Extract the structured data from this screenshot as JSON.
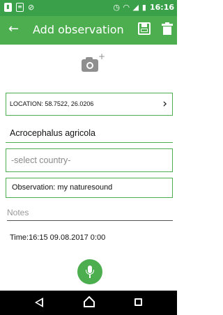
{
  "status_bar": {
    "time": "16:16",
    "icons": [
      "sim-icon",
      "clipboard-icon",
      "no-signal-icon",
      "alarm-icon",
      "wifi-icon",
      "cell-signal-icon",
      "battery-icon"
    ]
  },
  "app_bar": {
    "title": "Add observation",
    "icons": [
      "back-arrow-icon",
      "save-icon",
      "trash-icon"
    ]
  },
  "form": {
    "camera_icon": "add-photo-icon",
    "location": "LOCATION: 58.7522, 26.0206",
    "species": "Acrocephalus agricola",
    "country_placeholder": "-select country-",
    "observation": "Observation: my naturesound",
    "notes_placeholder": "Notes",
    "time": "Time:16:15 09.08.2017  0:00",
    "mic_icon": "microphone-icon"
  },
  "nav_bar": {
    "icons": [
      "back-triangle-icon",
      "home-icon",
      "recent-apps-icon"
    ]
  },
  "colors": {
    "status_bar": "#3aa14a",
    "app_bar": "#4cae4f",
    "accent": "#4cae4f"
  }
}
